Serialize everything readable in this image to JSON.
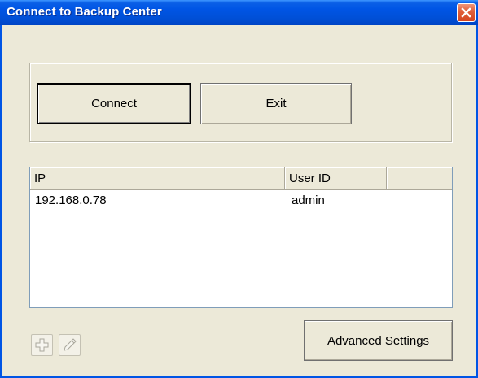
{
  "window": {
    "title": "Connect to Backup Center"
  },
  "actions": {
    "connect_label": "Connect",
    "exit_label": "Exit",
    "advanced_label": "Advanced Settings"
  },
  "list": {
    "columns": [
      "IP",
      "User ID",
      ""
    ],
    "rows": [
      {
        "ip": "192.168.0.78",
        "user_id": "admin"
      }
    ]
  },
  "icons": {
    "close": "close-icon",
    "add": "add-icon",
    "edit": "pencil-icon"
  },
  "colors": {
    "titlebar": "#0055e5",
    "close_button": "#d5451f",
    "dialog_background": "#ece9d8",
    "list_border": "#7f9db9"
  }
}
